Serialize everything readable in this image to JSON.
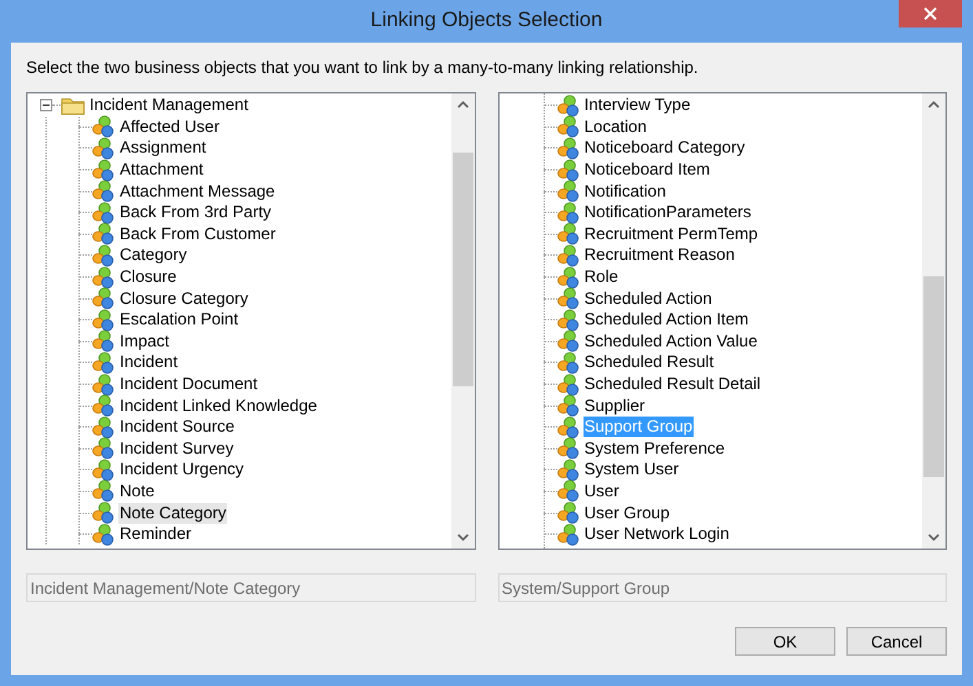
{
  "window": {
    "title": "Linking Objects Selection"
  },
  "instruction": "Select the two business objects that you want to link by a many-to-many linking relationship.",
  "left_tree": {
    "focused": false,
    "items": [
      {
        "label": "Incident Management",
        "expanded": true,
        "selected": false,
        "children": [
          {
            "label": "Affected User",
            "selected": false
          },
          {
            "label": "Assignment",
            "selected": false
          },
          {
            "label": "Attachment",
            "selected": false
          },
          {
            "label": "Attachment Message",
            "selected": false
          },
          {
            "label": "Back From 3rd Party",
            "selected": false
          },
          {
            "label": "Back From Customer",
            "selected": false
          },
          {
            "label": "Category",
            "selected": false
          },
          {
            "label": "Closure",
            "selected": false
          },
          {
            "label": "Closure Category",
            "selected": false
          },
          {
            "label": "Escalation Point",
            "selected": false
          },
          {
            "label": "Impact",
            "selected": false
          },
          {
            "label": "Incident",
            "selected": false
          },
          {
            "label": "Incident Document",
            "selected": false
          },
          {
            "label": "Incident Linked Knowledge",
            "selected": false
          },
          {
            "label": "Incident Source",
            "selected": false
          },
          {
            "label": "Incident Survey",
            "selected": false
          },
          {
            "label": "Incident Urgency",
            "selected": false
          },
          {
            "label": "Note",
            "selected": false
          },
          {
            "label": "Note Category",
            "selected": true
          },
          {
            "label": "Reminder",
            "selected": false
          }
        ]
      }
    ]
  },
  "right_tree": {
    "focused": true,
    "items": [
      {
        "label": "Interview Type",
        "selected": false
      },
      {
        "label": "Location",
        "selected": false
      },
      {
        "label": "Noticeboard Category",
        "selected": false
      },
      {
        "label": "Noticeboard Item",
        "selected": false
      },
      {
        "label": "Notification",
        "selected": false
      },
      {
        "label": "NotificationParameters",
        "selected": false
      },
      {
        "label": "Recruitment PermTemp",
        "selected": false
      },
      {
        "label": "Recruitment Reason",
        "selected": false
      },
      {
        "label": "Role",
        "selected": false
      },
      {
        "label": "Scheduled Action",
        "selected": false
      },
      {
        "label": "Scheduled Action Item",
        "selected": false
      },
      {
        "label": "Scheduled Action Value",
        "selected": false
      },
      {
        "label": "Scheduled Result",
        "selected": false
      },
      {
        "label": "Scheduled Result Detail",
        "selected": false
      },
      {
        "label": "Supplier",
        "selected": false
      },
      {
        "label": "Support Group",
        "selected": true
      },
      {
        "label": "System Preference",
        "selected": false
      },
      {
        "label": "System User",
        "selected": false
      },
      {
        "label": "User",
        "selected": false
      },
      {
        "label": "User Group",
        "selected": false
      },
      {
        "label": "User Network Login",
        "selected": false
      }
    ]
  },
  "left_path": {
    "value": "Incident Management/Note Category",
    "disabled": true
  },
  "right_path": {
    "value": "System/Support Group",
    "disabled": true
  },
  "buttons": [
    "OK",
    "Cancel"
  ]
}
